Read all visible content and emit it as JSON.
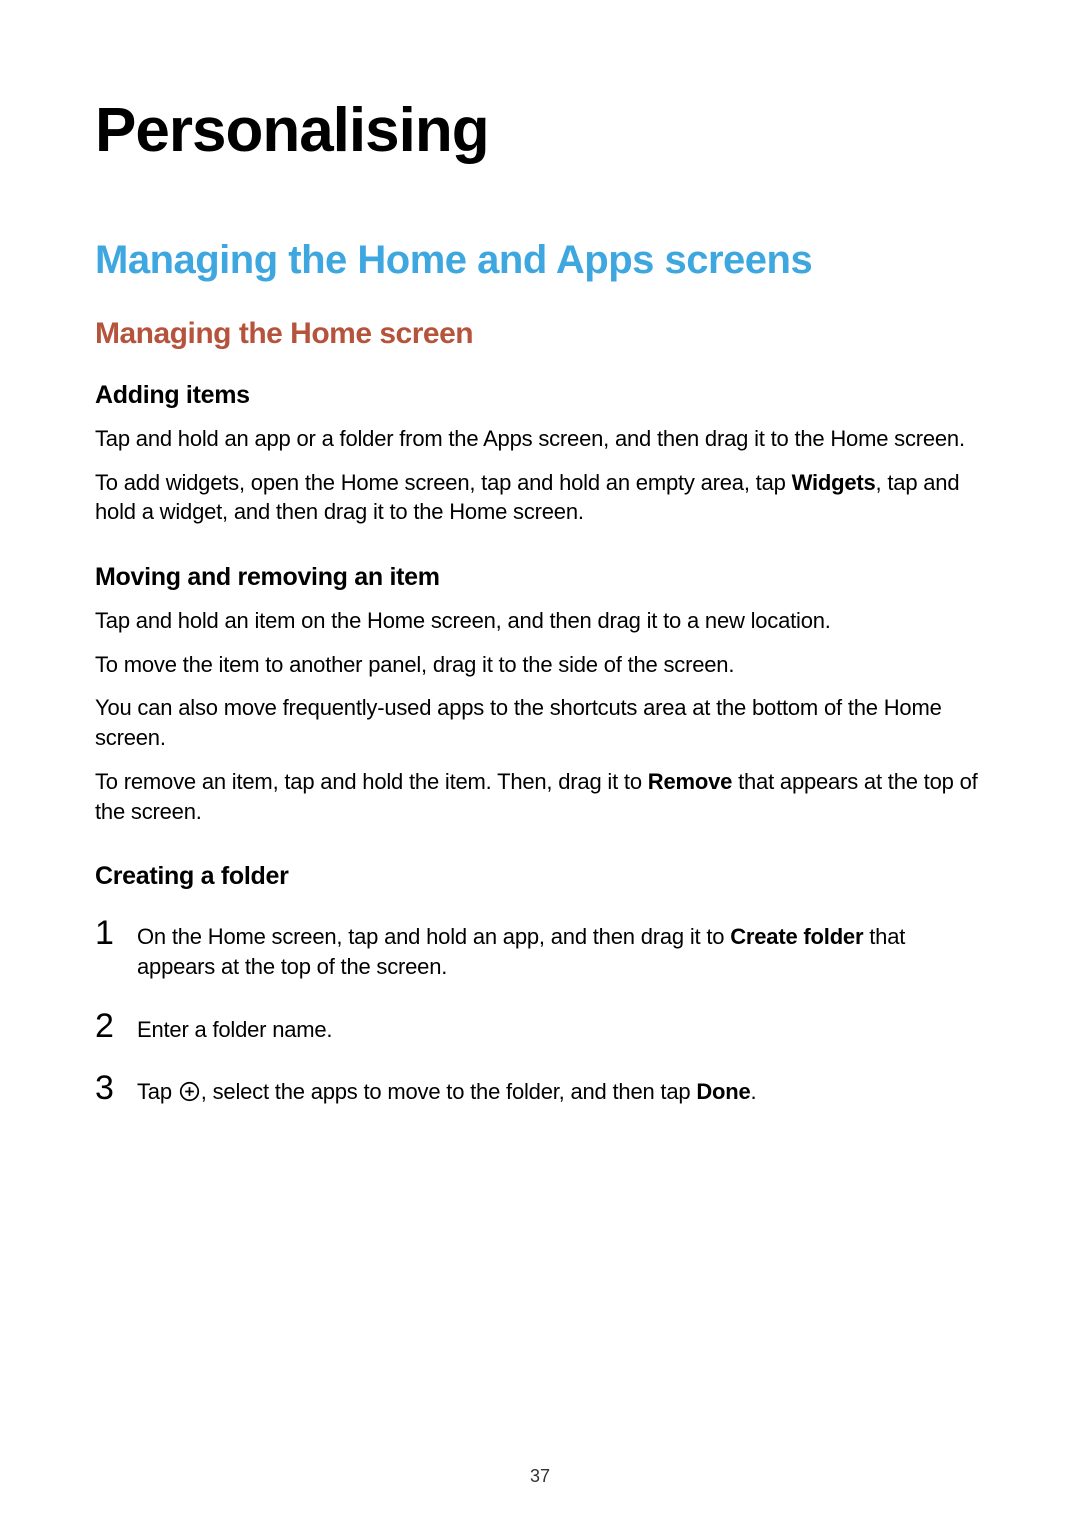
{
  "title": "Personalising",
  "section": "Managing the Home and Apps screens",
  "subsection": "Managing the Home screen",
  "adding": {
    "heading": "Adding items",
    "p1": "Tap and hold an app or a folder from the Apps screen, and then drag it to the Home screen.",
    "p2_a": "To add widgets, open the Home screen, tap and hold an empty area, tap ",
    "p2_bold": "Widgets",
    "p2_b": ", tap and hold a widget, and then drag it to the Home screen."
  },
  "moving": {
    "heading": "Moving and removing an item",
    "p1": "Tap and hold an item on the Home screen, and then drag it to a new location.",
    "p2": "To move the item to another panel, drag it to the side of the screen.",
    "p3": "You can also move frequently-used apps to the shortcuts area at the bottom of the Home screen.",
    "p4_a": "To remove an item, tap and hold the item. Then, drag it to ",
    "p4_bold": "Remove",
    "p4_b": " that appears at the top of the screen."
  },
  "creating": {
    "heading": "Creating a folder",
    "step1_num": "1",
    "step1_a": "On the Home screen, tap and hold an app, and then drag it to ",
    "step1_bold": "Create folder",
    "step1_b": " that appears at the top of the screen.",
    "step2_num": "2",
    "step2": "Enter a folder name.",
    "step3_num": "3",
    "step3_a": "Tap ",
    "step3_b": ", select the apps to move to the folder, and then tap ",
    "step3_bold": "Done",
    "step3_c": "."
  },
  "page_number": "37"
}
